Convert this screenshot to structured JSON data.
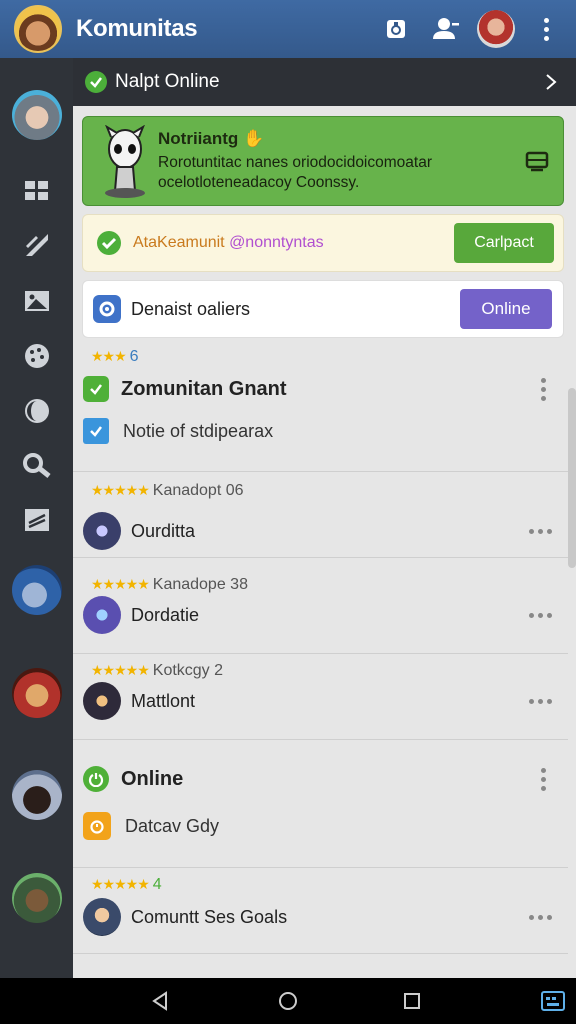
{
  "app": {
    "title": "Komunitas",
    "icons": [
      "share-icon",
      "contacts-icon",
      "user-avatar",
      "more-vert-icon"
    ]
  },
  "status": {
    "label": "Nalpt Online"
  },
  "notification": {
    "title": "Notriiantg",
    "body": "Rorotuntitac nanes oriodocidoicomoatar ocelotloteneadacoy Coonssy."
  },
  "promo": {
    "handle_prefix": "AtaKeamunit",
    "handle": "@nonntyntas",
    "button": "Carlpact"
  },
  "online_card": {
    "label": "Denaist oaliers",
    "button": "Online"
  },
  "group1": {
    "rating_count": "6",
    "title": "Zomunitan Gnant",
    "subtitle": "Notie of stdipearax"
  },
  "items": [
    {
      "meta": "Kanadopt 06",
      "name": "Ourditta",
      "avatar_color": "#3a3f6a"
    },
    {
      "meta": "Kanadope 38",
      "name": "Dordatie",
      "avatar_color": "#5a4fb0"
    },
    {
      "meta": "Kotkcgy 2",
      "name": "Mattlont",
      "avatar_color": "#2e2a3a"
    }
  ],
  "group2": {
    "title": "Online",
    "subtitle": "Datcav Gdy"
  },
  "last_item": {
    "rating_count": "4",
    "name": "Comuntt Ses Goals"
  },
  "rail": {
    "icons": [
      "grid-icon",
      "edit-icon",
      "image-icon",
      "palette-icon",
      "moon-icon",
      "search-icon",
      "note-icon"
    ]
  },
  "colors": {
    "appbar": "#3f6aa3",
    "rail": "#2f3339",
    "notif_green": "#67b34b",
    "online_purple": "#7462c9",
    "contact_green": "#58a83b"
  }
}
